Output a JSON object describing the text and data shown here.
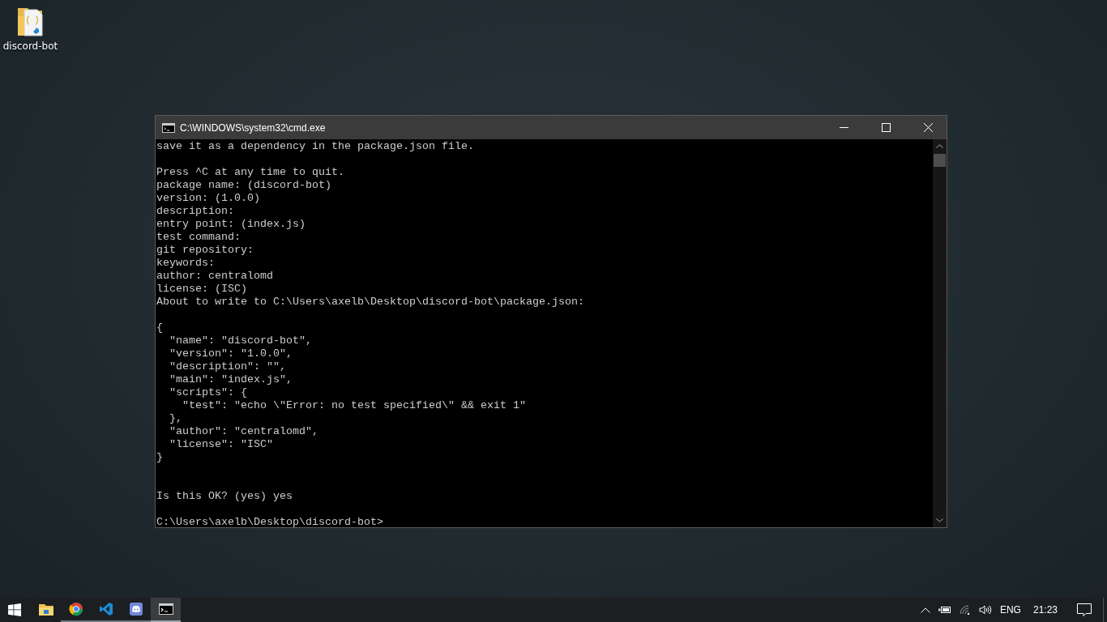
{
  "desktop_icons": [
    {
      "label": "discord-bot"
    }
  ],
  "window": {
    "title": "C:\\WINDOWS\\system32\\cmd.exe",
    "lines": [
      {
        "kind": "text",
        "text": "save it as a dependency in the package.json file."
      },
      {
        "kind": "blank"
      },
      {
        "kind": "text",
        "text": "Press ^C at any time to quit."
      },
      {
        "kind": "text",
        "text": "package name: (discord-bot)"
      },
      {
        "kind": "text",
        "text": "version: (1.0.0)"
      },
      {
        "kind": "text",
        "text": "description:"
      },
      {
        "kind": "text",
        "text": "entry point: (index.js)"
      },
      {
        "kind": "text",
        "text": "test command:"
      },
      {
        "kind": "text",
        "text": "git repository:"
      },
      {
        "kind": "text",
        "text": "keywords:"
      },
      {
        "kind": "text",
        "text": "author: centralomd"
      },
      {
        "kind": "text",
        "text": "license: (ISC)"
      },
      {
        "kind": "text",
        "text": "About to write to C:\\Users\\axelb\\Desktop\\discord-bot\\package.json:"
      },
      {
        "kind": "blank"
      },
      {
        "kind": "text",
        "text": "{"
      },
      {
        "kind": "text",
        "text": "  \"name\": \"discord-bot\","
      },
      {
        "kind": "text",
        "text": "  \"version\": \"1.0.0\","
      },
      {
        "kind": "text",
        "text": "  \"description\": \"\","
      },
      {
        "kind": "text",
        "text": "  \"main\": \"index.js\","
      },
      {
        "kind": "text",
        "text": "  \"scripts\": {"
      },
      {
        "kind": "text",
        "text": "    \"test\": \"echo \\\"Error: no test specified\\\" && exit 1\""
      },
      {
        "kind": "text",
        "text": "  },"
      },
      {
        "kind": "text",
        "text": "  \"author\": \"centralomd\","
      },
      {
        "kind": "text",
        "text": "  \"license\": \"ISC\""
      },
      {
        "kind": "text",
        "text": "}"
      },
      {
        "kind": "blank"
      },
      {
        "kind": "blank"
      },
      {
        "kind": "text",
        "text": "Is this OK? (yes) yes"
      },
      {
        "kind": "blank"
      },
      {
        "kind": "text",
        "text": "C:\\Users\\axelb\\Desktop\\discord-bot>"
      }
    ]
  },
  "taskbar": {
    "apps": [
      {
        "kind": "folder",
        "running": false,
        "selected": false
      },
      {
        "kind": "globe",
        "running": true,
        "selected": false
      },
      {
        "kind": "code",
        "running": true,
        "selected": false
      },
      {
        "kind": "chat",
        "running": true,
        "selected": false
      },
      {
        "kind": "terminal",
        "running": true,
        "selected": true
      }
    ],
    "language": "ENG",
    "time": "21:23"
  }
}
